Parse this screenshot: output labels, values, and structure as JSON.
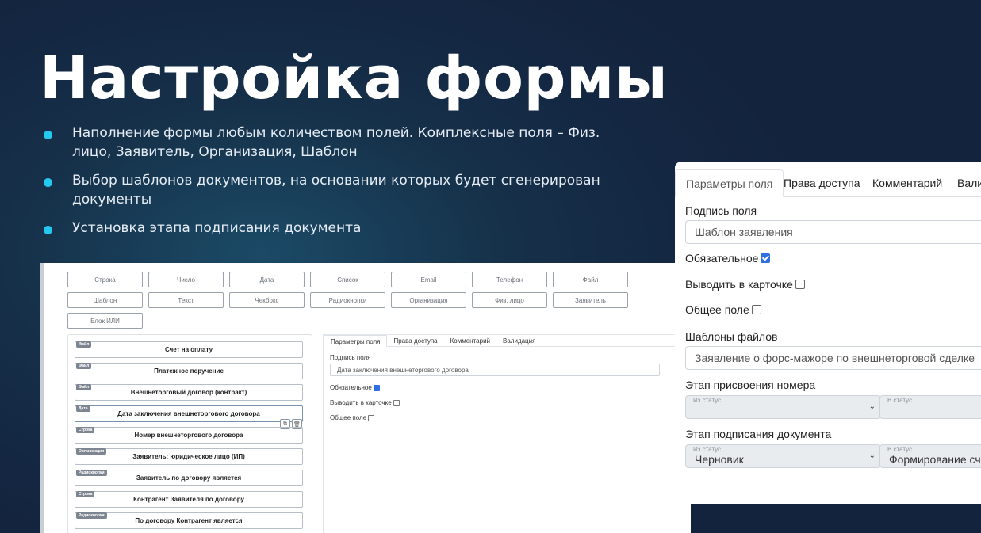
{
  "slide": {
    "title": "Настройка формы",
    "bullets": [
      "Наполнение формы любым количеством полей. Комплексные поля – Физ. лицо, Заявитель, Организация, Шаблон",
      "Выбор шаблонов документов, на основании которых будет сгенерирован документы",
      "Установка этапа подписания документа"
    ],
    "accent_color": "#25c8f0"
  },
  "field_types": [
    "Строка",
    "Число",
    "Дата",
    "Список",
    "Email",
    "Телефон",
    "Файл",
    "Шаблон",
    "Текст",
    "Чекбокс",
    "Радиокнопки",
    "Организация",
    "Физ. лицо",
    "Заявитель",
    "Блок ИЛИ"
  ],
  "form_fields": [
    {
      "tag": "Файл",
      "label": "Счет на оплату"
    },
    {
      "tag": "Файл",
      "label": "Платежное поручение"
    },
    {
      "tag": "Файл",
      "label": "Внешнеторговый договор (контракт)"
    },
    {
      "tag": "Дата",
      "label": "Дата заключения внешнеторгового договора"
    },
    {
      "tag": "Строка",
      "label": "Номер внешнеторгового договора"
    },
    {
      "tag": "Организация",
      "label": "Заявитель: юридическое лицо (ИП)"
    },
    {
      "tag": "Радиокнопки",
      "label": "Заявитель по договору является"
    },
    {
      "tag": "Строка",
      "label": "Контрагент Заявителя по договору"
    },
    {
      "tag": "Радиокнопки",
      "label": "По договору Контрагент является"
    }
  ],
  "small_props": {
    "tabs": [
      "Параметры поля",
      "Права доступа",
      "Комментарий",
      "Валидация"
    ],
    "caption_label": "Подпись поля",
    "caption_value": "Дата заключения внешнеторгового договора",
    "required_label": "Обязательное",
    "show_in_card_label": "Выводить в карточке",
    "common_field_label": "Общее поле"
  },
  "zoom_props": {
    "tabs": [
      "Параметры поля",
      "Права доступа",
      "Комментарий",
      "Вали"
    ],
    "caption_label": "Подпись поля",
    "caption_value": "Шаблон заявления",
    "required_label": "Обязательное",
    "show_in_card_label": "Выводить в карточке",
    "common_field_label": "Общее поле",
    "file_templates_label": "Шаблоны файлов",
    "file_templates_value": "Заявление о форс-мажоре по внешнеторговой сделке",
    "numbering_stage_label": "Этап присвоения номера",
    "from_status_caption": "Из статус",
    "to_status_caption": "В статус",
    "signing_stage_label": "Этап подписания документа",
    "signing_from_value": "Черновик",
    "signing_to_value": "Формирование счет"
  }
}
